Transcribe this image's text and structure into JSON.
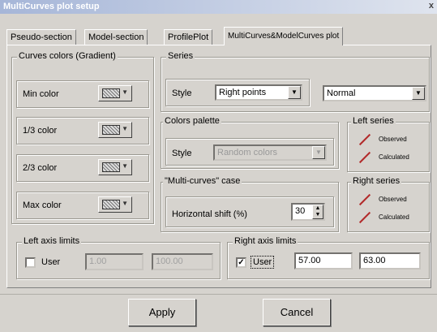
{
  "window": {
    "title": "MultiCurves plot setup",
    "close_glyph": "x"
  },
  "tabs": [
    {
      "label": "Pseudo-section"
    },
    {
      "label": "Model-section"
    },
    {
      "label": "ProfilePlot"
    },
    {
      "label": "MultiCurves&ModelCurves plot"
    }
  ],
  "curves_colors": {
    "legend": "Curves colors (Gradient)",
    "items": [
      {
        "label": "Min color"
      },
      {
        "label": "1/3 color"
      },
      {
        "label": "2/3 color"
      },
      {
        "label": "Max color"
      }
    ]
  },
  "series": {
    "legend": "Series",
    "style_label": "Style",
    "style_value": "Right points",
    "mode_value": "Normal"
  },
  "palette": {
    "legend": "Colors palette",
    "style_label": "Style",
    "style_value": "Random colors"
  },
  "multicurves": {
    "legend": "\"Multi-curves\" case",
    "shift_label": "Horizontal shift (%)",
    "shift_value": "30"
  },
  "left_series": {
    "legend": "Left series",
    "observed": "Observed",
    "calculated": "Calculated",
    "color": "#b22a2a"
  },
  "right_series": {
    "legend": "Right series",
    "observed": "Observed",
    "calculated": "Calculated",
    "color": "#b22a2a"
  },
  "left_axis": {
    "legend": "Left axis limits",
    "user_label": "User",
    "user_checked": false,
    "min": "1.00",
    "max": "100.00"
  },
  "right_axis": {
    "legend": "Right axis limits",
    "user_label": "User",
    "user_checked": true,
    "check_glyph": "✓",
    "min": "57.00",
    "max": "63.00"
  },
  "buttons": {
    "apply": "Apply",
    "cancel": "Cancel"
  }
}
